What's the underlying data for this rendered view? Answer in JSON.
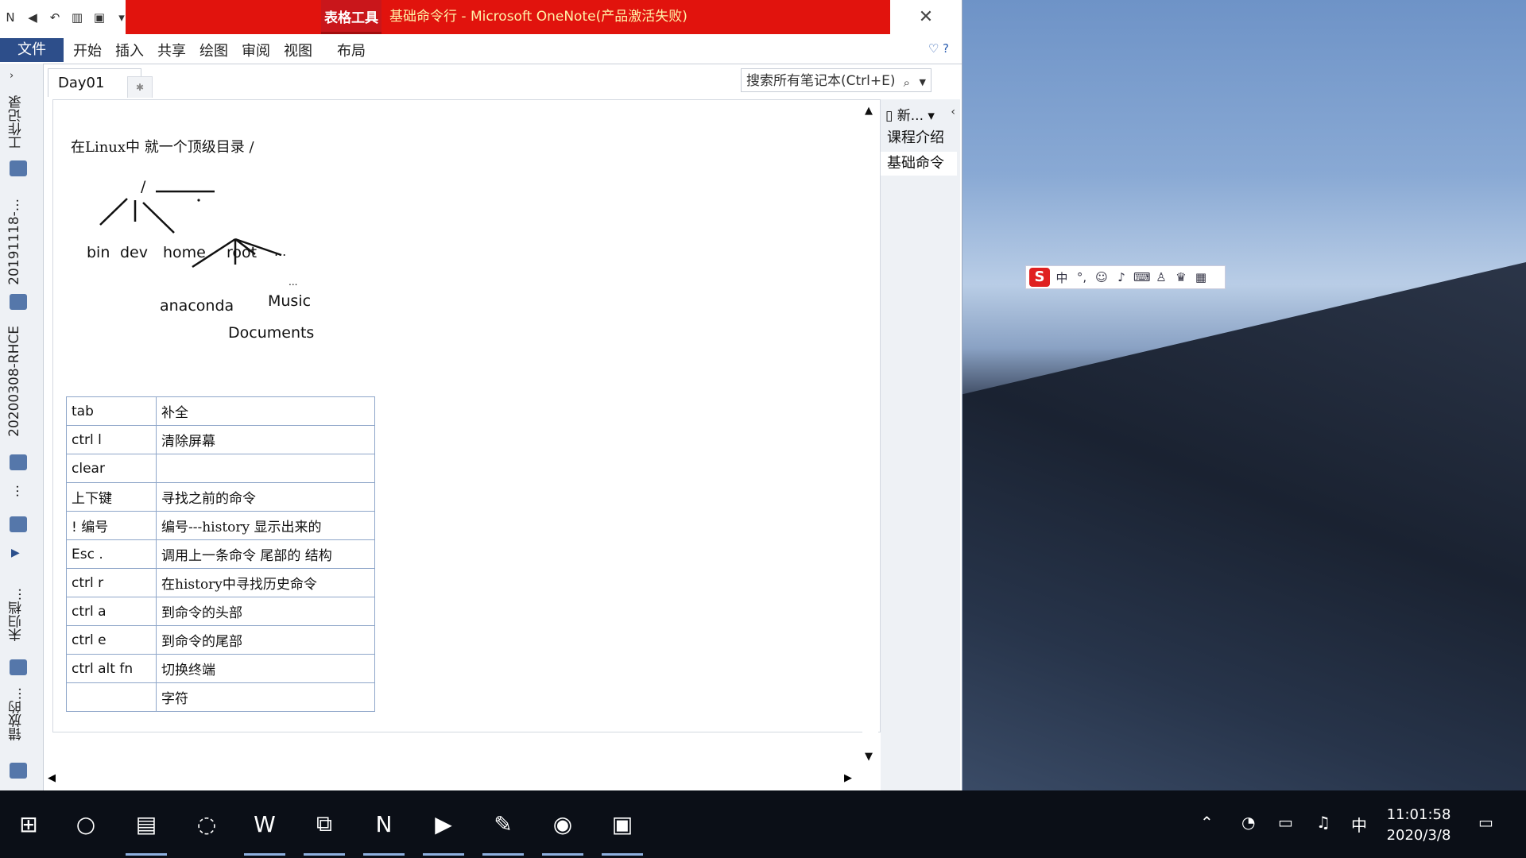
{
  "window": {
    "contextual_tab": "表格工具",
    "title": "基础命令行 - Microsoft OneNote(产品激活失败)"
  },
  "ribbon": {
    "file": "文件",
    "tabs": [
      "开始",
      "插入",
      "共享",
      "绘图",
      "审阅",
      "视图"
    ],
    "context_tabs": [
      "布局"
    ]
  },
  "notebook_nav": {
    "sections": [
      "工作记录",
      "20191118-...",
      "20200308-RHCE",
      "...",
      "未归档...",
      "错放的..."
    ]
  },
  "page_tab": "Day01",
  "search": {
    "placeholder": "搜索所有笔记本(Ctrl+E)"
  },
  "page": {
    "intro": "在Linux中 就一个顶级目录   /",
    "tree": {
      "root_slash": "/",
      "dirs": [
        "bin",
        "dev",
        "home",
        "root",
        "..."
      ],
      "root_children": [
        "anaconda",
        "Music",
        "Documents"
      ],
      "ellipsis": "..."
    },
    "commands": [
      {
        "key": "tab",
        "desc": "补全"
      },
      {
        "key": "ctrl  l",
        "desc": "清除屏幕"
      },
      {
        "key": "clear",
        "desc": ""
      },
      {
        "key": "上下键",
        "desc": "寻找之前的命令"
      },
      {
        "key": "!  编号",
        "desc": "编号---history 显示出来的"
      },
      {
        "key": "Esc   .",
        "desc": "调用上一条命令 尾部的 结构"
      },
      {
        "key": "ctrl  r",
        "desc": "在history中寻找历史命令"
      },
      {
        "key": "ctrl  a",
        "desc": "到命令的头部"
      },
      {
        "key": "ctrl  e",
        "desc": "到命令的尾部"
      },
      {
        "key": "ctrl  alt    fn",
        "desc": "切换终端"
      },
      {
        "key": "",
        "desc": "字符"
      }
    ]
  },
  "pages_panel": {
    "new_label": "新...",
    "pages": [
      "课程介绍",
      "基础命令"
    ],
    "selected": "基础命令"
  },
  "ime_bar": {
    "logo": "S",
    "mode": "中"
  },
  "taskbar": {
    "apps": [
      "windows-start",
      "search",
      "file-explorer",
      "loading",
      "word",
      "app-red",
      "onenote",
      "screen-recorder",
      "paint",
      "qq",
      "zoom"
    ],
    "tray_lang": "中",
    "time": "11:01:58",
    "date": "2020/3/8"
  },
  "colors": {
    "title_bar_red": "#e1130d",
    "file_tab_blue": "#2d4e8a",
    "table_border": "#8ea6c9"
  }
}
